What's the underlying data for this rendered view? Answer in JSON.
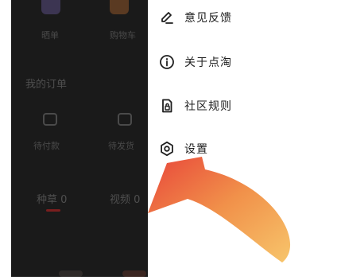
{
  "background_app": {
    "top_labels": [
      "晒单",
      "购物车"
    ],
    "section_title": "我的订单",
    "order_items": [
      "待付款",
      "待发货"
    ],
    "tabs": [
      {
        "label": "种草 0"
      },
      {
        "label": "视频 0"
      }
    ]
  },
  "drawer": {
    "items": [
      {
        "label": "意见反馈",
        "icon": "pencil-icon"
      },
      {
        "label": "关于点淘",
        "icon": "info-icon"
      },
      {
        "label": "社区规则",
        "icon": "rules-document-icon"
      },
      {
        "label": "设置",
        "icon": "gear-icon"
      }
    ]
  },
  "overlay": {
    "arrow_icon": "curved-arrow-icon",
    "arrow_gradient": [
      "#e8463a",
      "#f1914a",
      "#f7c56b"
    ]
  },
  "colors": {
    "dim_background": "#1a1a1a",
    "drawer_background": "#ffffff",
    "menu_text": "#1f1f1f",
    "tab_underline": "#7a1e1e"
  }
}
